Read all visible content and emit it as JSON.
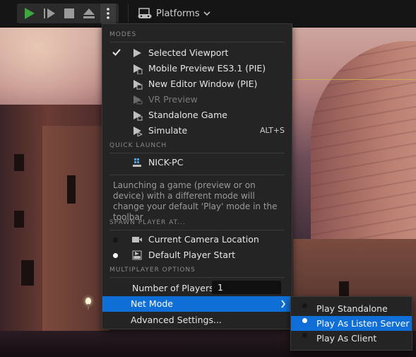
{
  "toolbar": {
    "buttons": [
      {
        "icon": "play-icon"
      },
      {
        "icon": "skip-frame-icon"
      },
      {
        "icon": "stop-icon"
      },
      {
        "icon": "eject-icon"
      },
      {
        "icon": "more-options-icon"
      }
    ],
    "platforms": {
      "label": "Platforms",
      "icon": "gamepad-monitor-icon",
      "chevron": "chevron-down-icon"
    }
  },
  "menu": {
    "modes": {
      "title": "MODES",
      "items": [
        {
          "label": "Selected Viewport",
          "checked": true,
          "icon": "play-arrow-icon"
        },
        {
          "label": "Mobile Preview ES3.1 (PIE)",
          "icon": "mobile-preview-icon"
        },
        {
          "label": "New Editor Window (PIE)",
          "icon": "editor-window-icon"
        },
        {
          "label": "VR Preview",
          "disabled": true,
          "icon": "vr-preview-icon"
        },
        {
          "label": "Standalone Game",
          "icon": "standalone-game-icon"
        },
        {
          "label": "Simulate",
          "shortcut": "ALT+S",
          "icon": "simulate-icon"
        }
      ]
    },
    "quick_launch": {
      "title": "QUICK LAUNCH",
      "items": [
        {
          "label": "NICK-PC",
          "icon": "windows-pc-icon"
        }
      ]
    },
    "description": "Launching a game (preview or on device) with a different mode will change your default 'Play' mode in the toolbar",
    "spawn": {
      "title": "SPAWN PLAYER AT...",
      "items": [
        {
          "label": "Current Camera Location",
          "selected": false,
          "icon": "camera-icon"
        },
        {
          "label": "Default Player Start",
          "selected": true,
          "icon": "player-start-icon"
        }
      ]
    },
    "multiplayer": {
      "title": "MULTIPLAYER OPTIONS",
      "number_of_players_label": "Number of Players",
      "number_of_players_value": "1",
      "net_mode_label": "Net Mode",
      "advanced_label": "Advanced Settings..."
    }
  },
  "net_mode_submenu": {
    "items": [
      {
        "label": "Play Standalone",
        "selected": false
      },
      {
        "label": "Play As Listen Server",
        "selected": true
      },
      {
        "label": "Play As Client",
        "selected": false
      }
    ]
  },
  "colors": {
    "accent": "#0f6fd6",
    "play_green": "#3aa83a",
    "menu_bg": "#242424"
  }
}
